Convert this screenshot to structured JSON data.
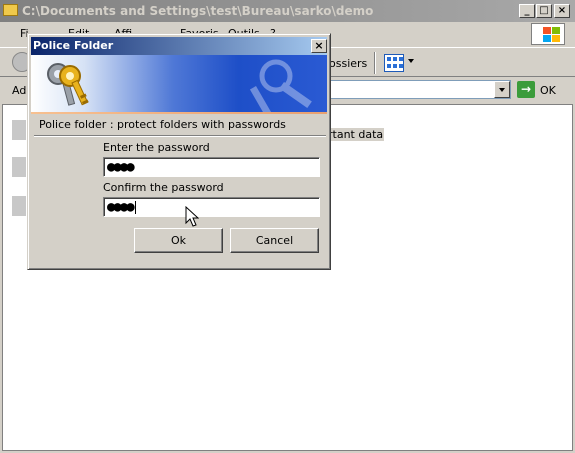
{
  "explorer": {
    "title": "C:\\Documents and Settings\\test\\Bureau\\sarko\\demo",
    "menu": [
      "Fi",
      "Edit",
      "Affi",
      "Favoris",
      "Outils",
      "?"
    ],
    "toolbar": {
      "folders_label": "ossiers"
    },
    "address": {
      "label": "Adr",
      "go_label": "OK"
    },
    "content": {
      "visible_text": "rtant data"
    }
  },
  "dialog": {
    "title": "Police Folder",
    "description": "Police folder : protect folders with passwords",
    "password_label": "Enter the password",
    "password_value": "●●●●",
    "confirm_label": "Confirm the password",
    "confirm_value": "●●●●",
    "ok_label": "Ok",
    "cancel_label": "Cancel"
  },
  "icons": {
    "window_folder": "folder-icon",
    "keys": "keys-icon",
    "go": "go-arrow-icon"
  }
}
